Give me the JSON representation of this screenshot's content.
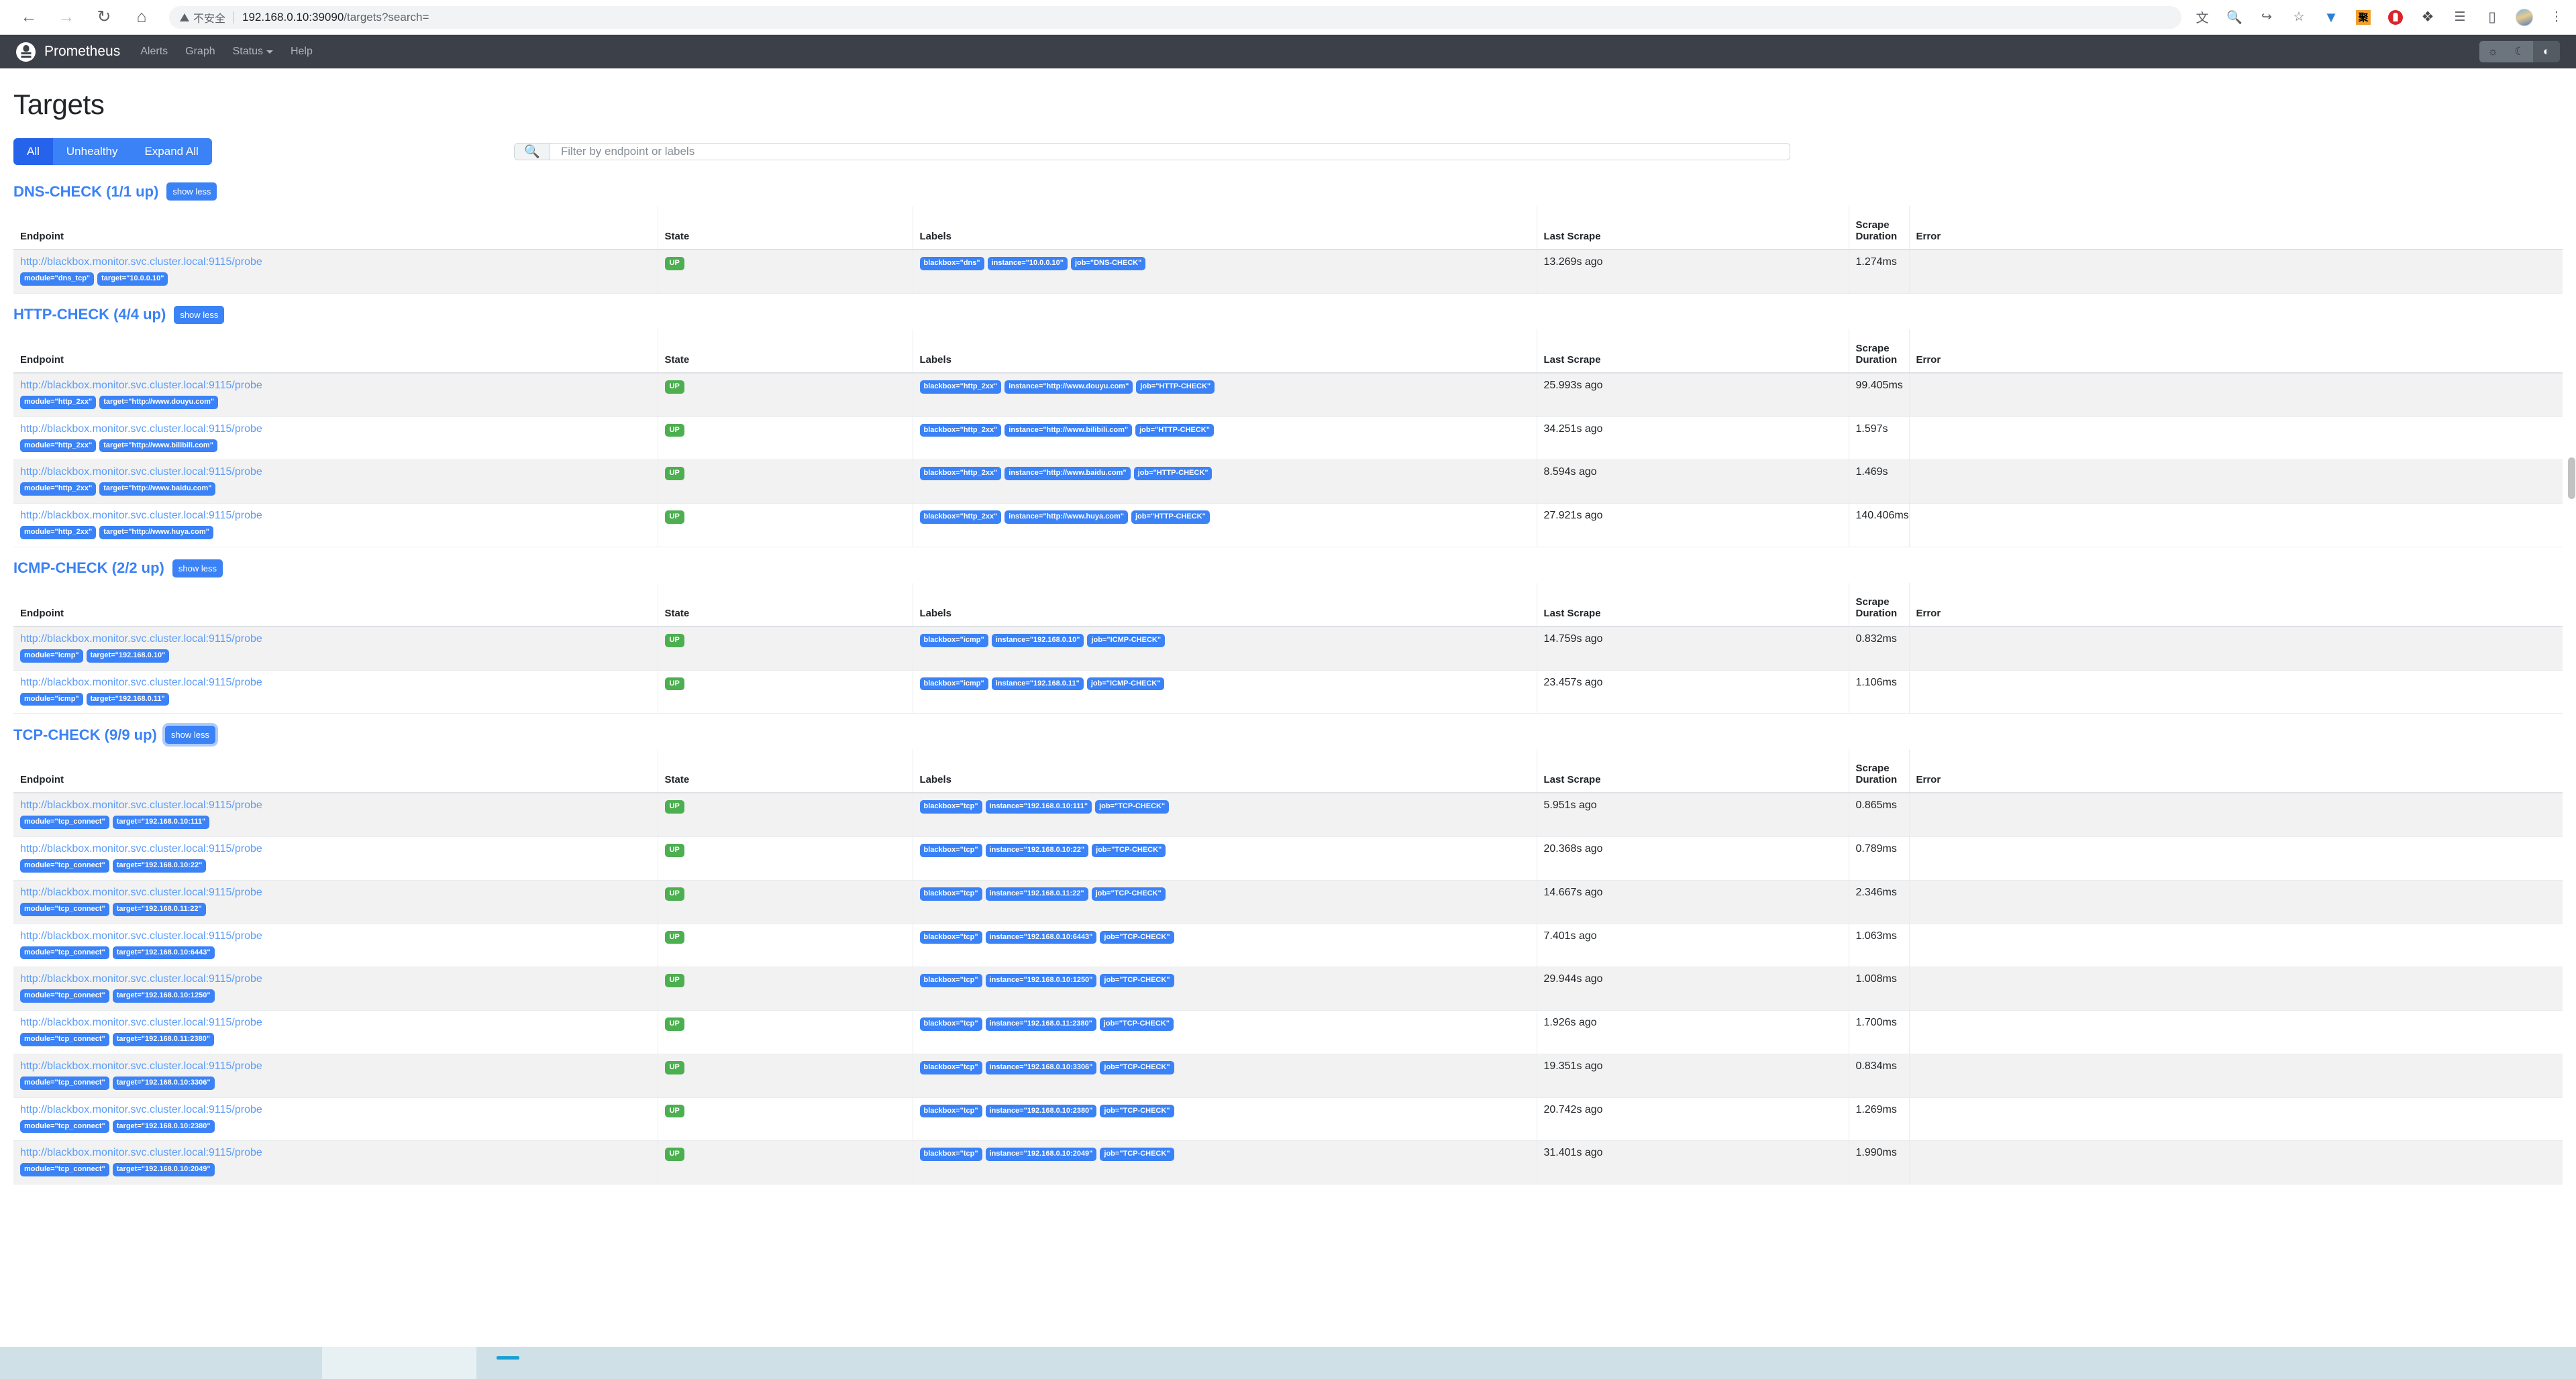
{
  "browser": {
    "back_icon": "back-arrow-icon",
    "forward_icon": "forward-arrow-icon",
    "reload_icon": "reload-icon",
    "home_icon": "home-icon",
    "security_label": "不安全",
    "url_host": "192.168.0.10:39090",
    "url_path": "/targets?search=",
    "right_icons": [
      {
        "name": "translate-icon",
        "glyph": "文"
      },
      {
        "name": "zoom-out-icon",
        "glyph": "⊖"
      },
      {
        "name": "share-icon",
        "glyph": "↪"
      },
      {
        "name": "bookmark-star-icon",
        "glyph": "☆"
      },
      {
        "name": "balloon-extension-icon",
        "glyph": "▽"
      },
      {
        "name": "ji-extension-icon",
        "glyph": "聚"
      },
      {
        "name": "adblock-extension-icon",
        "glyph": ""
      },
      {
        "name": "puzzle-extensions-icon",
        "glyph": "✦"
      },
      {
        "name": "playlist-icon",
        "glyph": "≡"
      },
      {
        "name": "sidepanel-icon",
        "glyph": "▯"
      },
      {
        "name": "profile-avatar",
        "glyph": ""
      },
      {
        "name": "chrome-menu-icon",
        "glyph": "⋮"
      }
    ]
  },
  "navbar": {
    "brand": "Prometheus",
    "items": [
      {
        "label": "Alerts",
        "has_caret": false
      },
      {
        "label": "Graph",
        "has_caret": false
      },
      {
        "label": "Status",
        "has_caret": true
      },
      {
        "label": "Help",
        "has_caret": false
      }
    ],
    "theme_buttons": [
      {
        "name": "light-theme-button",
        "glyph": "☀",
        "active": false
      },
      {
        "name": "dark-theme-button",
        "glyph": "☾",
        "active": false
      },
      {
        "name": "auto-theme-button",
        "glyph": "◐",
        "active": true
      }
    ]
  },
  "page": {
    "title": "Targets",
    "filters": [
      {
        "label": "All",
        "active": true
      },
      {
        "label": "Unhealthy",
        "active": false
      },
      {
        "label": "Expand All",
        "active": false
      }
    ],
    "search": {
      "placeholder": "Filter by endpoint or labels",
      "value": "",
      "icon": "search-icon"
    }
  },
  "columns": [
    "Endpoint",
    "State",
    "Labels",
    "Scrape\nDuration",
    "Error"
  ],
  "column_headers": {
    "endpoint": "Endpoint",
    "state": "State",
    "labels": "Labels",
    "last_scrape": "Last Scrape",
    "scrape_duration_line1": "Scrape",
    "scrape_duration_line2": "Duration",
    "error": "Error"
  },
  "show_less_label": "show less",
  "endpoint_url": "http://blackbox.monitor.svc.cluster.local:9115/probe",
  "jobs": [
    {
      "title": "DNS-CHECK (1/1 up)",
      "focused": false,
      "rows": [
        {
          "endpoint": "http://blackbox.monitor.svc.cluster.local:9115/probe",
          "endpoint_labels": [
            "module=\"dns_tcp\"",
            "target=\"10.0.0.10\""
          ],
          "state": "UP",
          "labels": [
            "blackbox=\"dns\"",
            "instance=\"10.0.0.10\"",
            "job=\"DNS-CHECK\""
          ],
          "last_scrape": "13.269s ago",
          "duration": "1.274ms",
          "error": ""
        }
      ]
    },
    {
      "title": "HTTP-CHECK (4/4 up)",
      "focused": false,
      "rows": [
        {
          "endpoint": "http://blackbox.monitor.svc.cluster.local:9115/probe",
          "endpoint_labels": [
            "module=\"http_2xx\"",
            "target=\"http://www.douyu.com\""
          ],
          "state": "UP",
          "labels": [
            "blackbox=\"http_2xx\"",
            "instance=\"http://www.douyu.com\"",
            "job=\"HTTP-CHECK\""
          ],
          "last_scrape": "25.993s ago",
          "duration": "99.405ms",
          "error": ""
        },
        {
          "endpoint": "http://blackbox.monitor.svc.cluster.local:9115/probe",
          "endpoint_labels": [
            "module=\"http_2xx\"",
            "target=\"http://www.bilibili.com\""
          ],
          "state": "UP",
          "labels": [
            "blackbox=\"http_2xx\"",
            "instance=\"http://www.bilibili.com\"",
            "job=\"HTTP-CHECK\""
          ],
          "last_scrape": "34.251s ago",
          "duration": "1.597s",
          "error": ""
        },
        {
          "endpoint": "http://blackbox.monitor.svc.cluster.local:9115/probe",
          "endpoint_labels": [
            "module=\"http_2xx\"",
            "target=\"http://www.baidu.com\""
          ],
          "state": "UP",
          "labels": [
            "blackbox=\"http_2xx\"",
            "instance=\"http://www.baidu.com\"",
            "job=\"HTTP-CHECK\""
          ],
          "last_scrape": "8.594s ago",
          "duration": "1.469s",
          "error": ""
        },
        {
          "endpoint": "http://blackbox.monitor.svc.cluster.local:9115/probe",
          "endpoint_labels": [
            "module=\"http_2xx\"",
            "target=\"http://www.huya.com\""
          ],
          "state": "UP",
          "labels": [
            "blackbox=\"http_2xx\"",
            "instance=\"http://www.huya.com\"",
            "job=\"HTTP-CHECK\""
          ],
          "last_scrape": "27.921s ago",
          "duration": "140.406ms",
          "error": ""
        }
      ]
    },
    {
      "title": "ICMP-CHECK (2/2 up)",
      "focused": false,
      "rows": [
        {
          "endpoint": "http://blackbox.monitor.svc.cluster.local:9115/probe",
          "endpoint_labels": [
            "module=\"icmp\"",
            "target=\"192.168.0.10\""
          ],
          "state": "UP",
          "labels": [
            "blackbox=\"icmp\"",
            "instance=\"192.168.0.10\"",
            "job=\"ICMP-CHECK\""
          ],
          "last_scrape": "14.759s ago",
          "duration": "0.832ms",
          "error": ""
        },
        {
          "endpoint": "http://blackbox.monitor.svc.cluster.local:9115/probe",
          "endpoint_labels": [
            "module=\"icmp\"",
            "target=\"192.168.0.11\""
          ],
          "state": "UP",
          "labels": [
            "blackbox=\"icmp\"",
            "instance=\"192.168.0.11\"",
            "job=\"ICMP-CHECK\""
          ],
          "last_scrape": "23.457s ago",
          "duration": "1.106ms",
          "error": ""
        }
      ]
    },
    {
      "title": "TCP-CHECK (9/9 up)",
      "focused": true,
      "rows": [
        {
          "endpoint": "http://blackbox.monitor.svc.cluster.local:9115/probe",
          "endpoint_labels": [
            "module=\"tcp_connect\"",
            "target=\"192.168.0.10:111\""
          ],
          "state": "UP",
          "labels": [
            "blackbox=\"tcp\"",
            "instance=\"192.168.0.10:111\"",
            "job=\"TCP-CHECK\""
          ],
          "last_scrape": "5.951s ago",
          "duration": "0.865ms",
          "error": ""
        },
        {
          "endpoint": "http://blackbox.monitor.svc.cluster.local:9115/probe",
          "endpoint_labels": [
            "module=\"tcp_connect\"",
            "target=\"192.168.0.10:22\""
          ],
          "state": "UP",
          "labels": [
            "blackbox=\"tcp\"",
            "instance=\"192.168.0.10:22\"",
            "job=\"TCP-CHECK\""
          ],
          "last_scrape": "20.368s ago",
          "duration": "0.789ms",
          "error": ""
        },
        {
          "endpoint": "http://blackbox.monitor.svc.cluster.local:9115/probe",
          "endpoint_labels": [
            "module=\"tcp_connect\"",
            "target=\"192.168.0.11:22\""
          ],
          "state": "UP",
          "labels": [
            "blackbox=\"tcp\"",
            "instance=\"192.168.0.11:22\"",
            "job=\"TCP-CHECK\""
          ],
          "last_scrape": "14.667s ago",
          "duration": "2.346ms",
          "error": ""
        },
        {
          "endpoint": "http://blackbox.monitor.svc.cluster.local:9115/probe",
          "endpoint_labels": [
            "module=\"tcp_connect\"",
            "target=\"192.168.0.10:6443\""
          ],
          "state": "UP",
          "labels": [
            "blackbox=\"tcp\"",
            "instance=\"192.168.0.10:6443\"",
            "job=\"TCP-CHECK\""
          ],
          "last_scrape": "7.401s ago",
          "duration": "1.063ms",
          "error": ""
        },
        {
          "endpoint": "http://blackbox.monitor.svc.cluster.local:9115/probe",
          "endpoint_labels": [
            "module=\"tcp_connect\"",
            "target=\"192.168.0.10:1250\""
          ],
          "state": "UP",
          "labels": [
            "blackbox=\"tcp\"",
            "instance=\"192.168.0.10:1250\"",
            "job=\"TCP-CHECK\""
          ],
          "last_scrape": "29.944s ago",
          "duration": "1.008ms",
          "error": ""
        },
        {
          "endpoint": "http://blackbox.monitor.svc.cluster.local:9115/probe",
          "endpoint_labels": [
            "module=\"tcp_connect\"",
            "target=\"192.168.0.11:2380\""
          ],
          "state": "UP",
          "labels": [
            "blackbox=\"tcp\"",
            "instance=\"192.168.0.11:2380\"",
            "job=\"TCP-CHECK\""
          ],
          "last_scrape": "1.926s ago",
          "duration": "1.700ms",
          "error": ""
        },
        {
          "endpoint": "http://blackbox.monitor.svc.cluster.local:9115/probe",
          "endpoint_labels": [
            "module=\"tcp_connect\"",
            "target=\"192.168.0.10:3306\""
          ],
          "state": "UP",
          "labels": [
            "blackbox=\"tcp\"",
            "instance=\"192.168.0.10:3306\"",
            "job=\"TCP-CHECK\""
          ],
          "last_scrape": "19.351s ago",
          "duration": "0.834ms",
          "error": ""
        },
        {
          "endpoint": "http://blackbox.monitor.svc.cluster.local:9115/probe",
          "endpoint_labels": [
            "module=\"tcp_connect\"",
            "target=\"192.168.0.10:2380\""
          ],
          "state": "UP",
          "labels": [
            "blackbox=\"tcp\"",
            "instance=\"192.168.0.10:2380\"",
            "job=\"TCP-CHECK\""
          ],
          "last_scrape": "20.742s ago",
          "duration": "1.269ms",
          "error": ""
        },
        {
          "endpoint": "http://blackbox.monitor.svc.cluster.local:9115/probe",
          "endpoint_labels": [
            "module=\"tcp_connect\"",
            "target=\"192.168.0.10:2049\""
          ],
          "state": "UP",
          "labels": [
            "blackbox=\"tcp\"",
            "instance=\"192.168.0.10:2049\"",
            "job=\"TCP-CHECK\""
          ],
          "last_scrape": "31.401s ago",
          "duration": "1.990ms",
          "error": ""
        }
      ]
    }
  ],
  "colors": {
    "accent_blue": "#3b82f6",
    "accent_blue_active": "#2563eb",
    "up_green": "#4caf50",
    "navbar_bg": "#3c4048",
    "link_blue": "#5b9bf8"
  }
}
